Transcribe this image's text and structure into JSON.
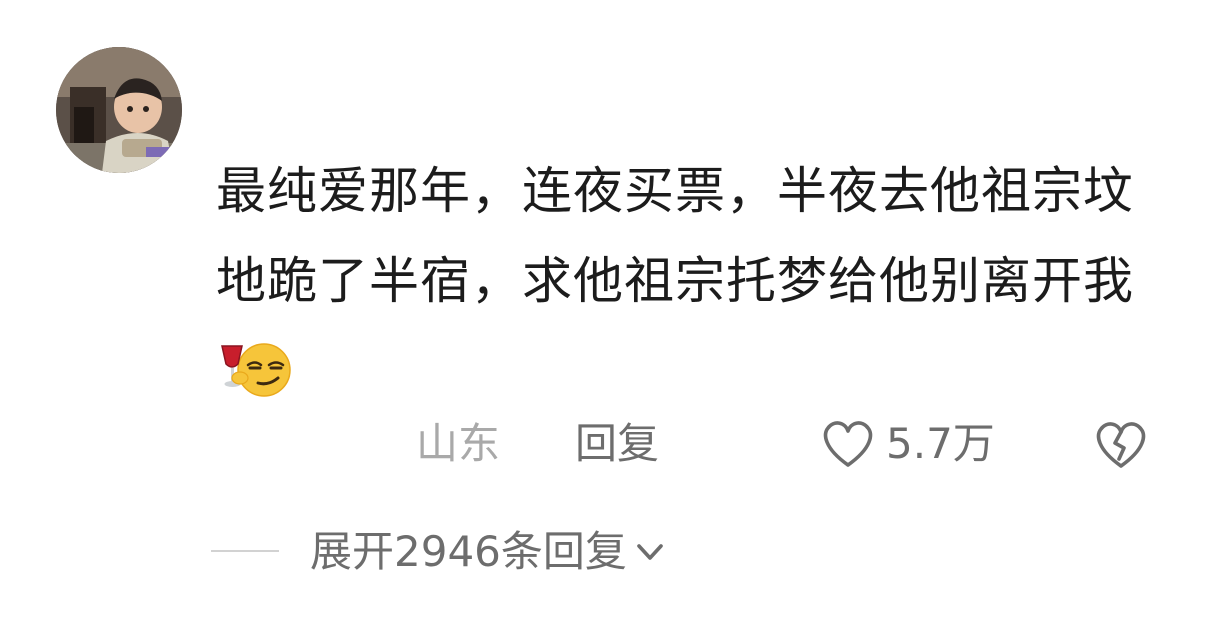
{
  "comment": {
    "avatar_icon": "user-avatar-photo",
    "text": "最纯爱那年，连夜买票，半夜去他祖宗坟地跪了半宿，求他祖宗托梦给他别离开我",
    "emoji_icon": "smirking-wine-emoji",
    "location": "山东",
    "reply_label": "回复",
    "like_icon": "heart-outline-icon",
    "like_count": "5.7万",
    "dislike_icon": "broken-heart-icon",
    "expand_label": "展开2946条回复",
    "expand_icon": "chevron-down-icon"
  },
  "colors": {
    "text_primary": "#1c1c1c",
    "text_secondary": "#6d6d6d",
    "text_muted": "#a9a9a9",
    "divider": "#d2d2d2"
  }
}
